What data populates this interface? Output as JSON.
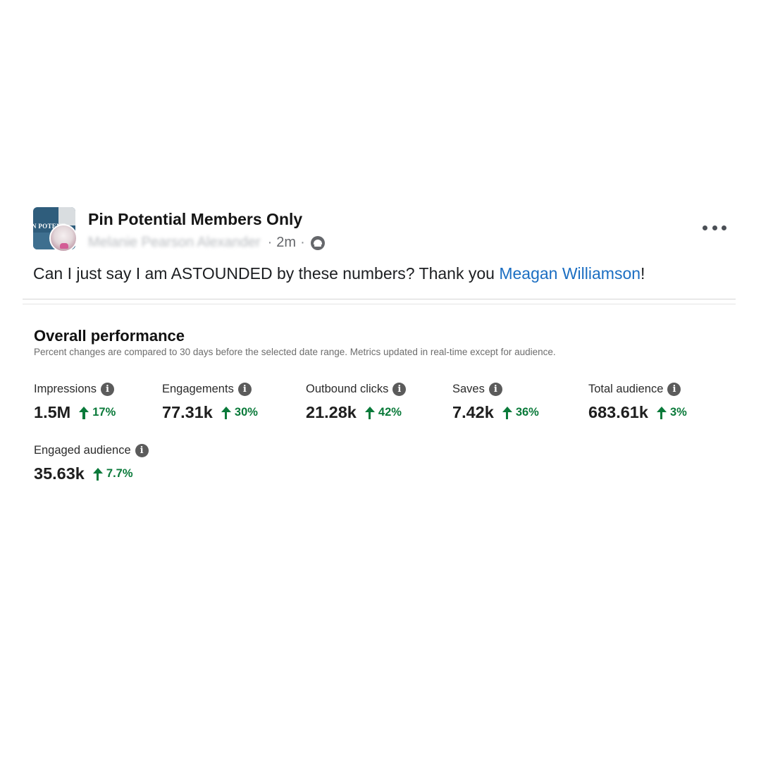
{
  "post": {
    "group_name": "Pin Potential Members Only",
    "author": "Melanie Pearson Alexander",
    "time": "2m",
    "text_before": "Can I just say I am ASTOUNDED by these numbers? Thank you ",
    "mention": "Meagan Williamson",
    "text_after": "!",
    "avatar_cover_text": "N POTENT"
  },
  "performance": {
    "title": "Overall performance",
    "subtitle": "Percent changes are compared to 30 days before the selected date range. Metrics updated in real-time except for audience.",
    "metrics": [
      {
        "label": "Impressions",
        "value": "1.5M",
        "change": "17%"
      },
      {
        "label": "Engagements",
        "value": "77.31k",
        "change": "30%"
      },
      {
        "label": "Outbound clicks",
        "value": "21.28k",
        "change": "42%"
      },
      {
        "label": "Saves",
        "value": "7.42k",
        "change": "36%"
      },
      {
        "label": "Total audience",
        "value": "683.61k",
        "change": "3%"
      },
      {
        "label": "Engaged audience",
        "value": "35.63k",
        "change": "7.7%"
      }
    ]
  },
  "icons": {
    "info": "i",
    "change_arrow": "arrow-up-icon",
    "audience": "group-audience-icon",
    "more": "more-options-icon"
  },
  "colors": {
    "mention": "#1b6ec2",
    "positive_change": "#0a7a3a"
  }
}
